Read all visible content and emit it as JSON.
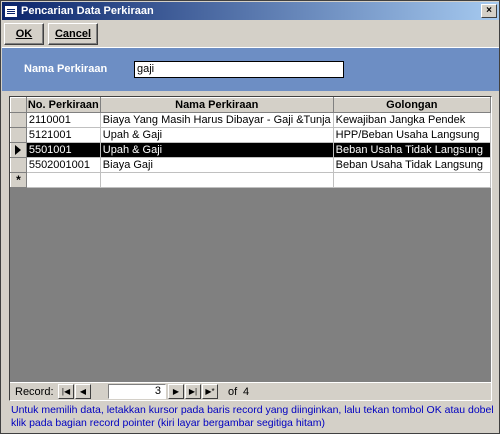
{
  "window": {
    "title": "Pencarian Data Perkiraan",
    "icon": "form-icon"
  },
  "toolbar": {
    "ok_label": "OK",
    "cancel_label": "Cancel"
  },
  "search": {
    "label": "Nama Perkiraan",
    "value": "gaji"
  },
  "table": {
    "columns": [
      "No. Perkiraan",
      "Nama Perkiraan",
      "Golongan"
    ],
    "rows": [
      {
        "no": "2110001",
        "nama": "Biaya Yang Masih Harus Dibayar - Gaji &Tunja",
        "golongan": "Kewajiban Jangka Pendek"
      },
      {
        "no": "5121001",
        "nama": "Upah & Gaji",
        "golongan": "HPP/Beban Usaha  Langsung"
      },
      {
        "no": "5501001",
        "nama": "Upah & Gaji",
        "golongan": "Beban Usaha Tidak Langsung"
      },
      {
        "no": "5502001001",
        "nama": "Biaya Gaji",
        "golongan": "Beban Usaha Tidak Langsung"
      }
    ],
    "current_row": 3,
    "new_row_marker": "*"
  },
  "navigation": {
    "label": "Record:",
    "current": "3",
    "of_label": "of",
    "total": "4"
  },
  "info_text": "Untuk memilih data, letakkan kursor pada baris record yang diinginkan, lalu tekan tombol OK atau dobel klik pada bagian record pointer (kiri layar bergambar segitiga hitam)"
}
